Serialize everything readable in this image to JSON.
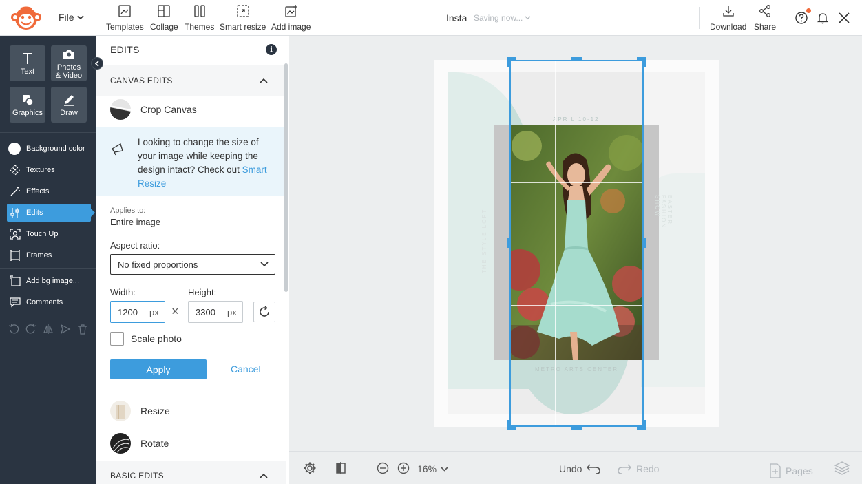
{
  "topbar": {
    "file_menu": "File",
    "tools": [
      {
        "label": "Templates",
        "icon": "templates-icon"
      },
      {
        "label": "Collage",
        "icon": "collage-icon"
      },
      {
        "label": "Themes",
        "icon": "themes-icon"
      },
      {
        "label": "Smart resize",
        "icon": "smart-resize-icon"
      },
      {
        "label": "Add image",
        "icon": "add-image-icon"
      }
    ],
    "doc_title": "Insta",
    "status": "Saving now...",
    "download": "Download",
    "share": "Share"
  },
  "sidebar": {
    "tiles": [
      {
        "label": "Text",
        "icon": "text-icon"
      },
      {
        "label_line1": "Photos",
        "label_line2": "& Video",
        "icon": "camera-icon"
      },
      {
        "label": "Graphics",
        "icon": "graphics-icon"
      },
      {
        "label": "Draw",
        "icon": "pencil-icon"
      }
    ],
    "items": [
      {
        "label": "Background color",
        "icon": "color-circle-icon"
      },
      {
        "label": "Textures",
        "icon": "textures-icon"
      },
      {
        "label": "Effects",
        "icon": "magic-wand-icon"
      },
      {
        "label": "Edits",
        "icon": "sliders-icon",
        "active": true
      },
      {
        "label": "Touch Up",
        "icon": "face-icon"
      },
      {
        "label": "Frames",
        "icon": "frame-icon"
      },
      {
        "label": "Add bg image...",
        "icon": "add-bg-icon"
      },
      {
        "label": "Comments",
        "icon": "comment-icon"
      }
    ]
  },
  "panel": {
    "title": "EDITS",
    "canvas_edits_header": "CANVAS EDITS",
    "crop_canvas": "Crop Canvas",
    "tip_text": "Looking to change the size of your image while keeping the design intact? Check out",
    "tip_link": "Smart Resize",
    "applies_to_label": "Applies to:",
    "applies_to_value": "Entire image",
    "aspect_label": "Aspect ratio:",
    "aspect_value": "No fixed proportions",
    "width_label": "Width:",
    "height_label": "Height:",
    "width_value": "1200",
    "height_value": "3300",
    "unit": "px",
    "times": "×",
    "scale_photo": "Scale photo",
    "apply": "Apply",
    "cancel": "Cancel",
    "resize": "Resize",
    "rotate": "Rotate",
    "basic_edits_header": "BASIC EDITS"
  },
  "canvas": {
    "text_top": "APRIL 10-12",
    "text_bottom": "METRO ARTS CENTER",
    "text_left": "THE STYLE LOFT",
    "text_right": "EASTER FASHION SHOW"
  },
  "bottombar": {
    "zoom": "16%",
    "undo": "Undo",
    "redo": "Redo",
    "pages": "Pages"
  },
  "colors": {
    "accent": "#3d9cdd",
    "sidebar_bg": "#2a3441",
    "notification": "#f06a3a"
  }
}
